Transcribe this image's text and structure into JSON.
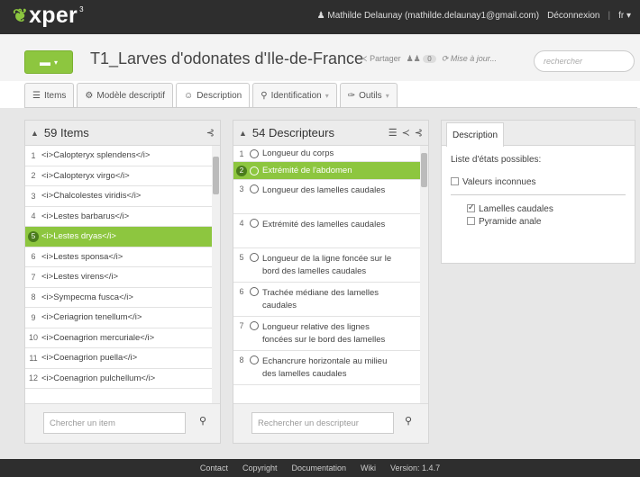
{
  "topbar": {
    "logo": "xper",
    "logo_sup": "3",
    "user": "Mathilde Delaunay (mathilde.delaunay1@gmail.com)",
    "logout": "Déconnexion",
    "lang": "fr"
  },
  "project": {
    "title": "T1_Larves d'odonates d'Ile-de-France",
    "share": "Partager",
    "badge": "0",
    "update": "Mise à jour...",
    "search_placeholder": "rechercher"
  },
  "tabs": [
    {
      "label": "Items"
    },
    {
      "label": "Modèle descriptif"
    },
    {
      "label": "Description"
    },
    {
      "label": "Identification"
    },
    {
      "label": "Outils"
    }
  ],
  "items_panel": {
    "title": "59 Items",
    "search_placeholder": "Chercher un item",
    "items": [
      {
        "num": "1",
        "label": "<i>Calopteryx splendens</i>"
      },
      {
        "num": "2",
        "label": "<i>Calopteryx virgo</i>"
      },
      {
        "num": "3",
        "label": "<i>Chalcolestes viridis</i>"
      },
      {
        "num": "4",
        "label": "<i>Lestes barbarus</i>"
      },
      {
        "num": "5",
        "label": "<i>Lestes dryas</i>"
      },
      {
        "num": "6",
        "label": "<i>Lestes sponsa</i>"
      },
      {
        "num": "7",
        "label": "<i>Lestes virens</i>"
      },
      {
        "num": "8",
        "label": "<i>Sympecma fusca</i>"
      },
      {
        "num": "9",
        "label": "<i>Ceriagrion tenellum</i>"
      },
      {
        "num": "10",
        "label": "<i>Coenagrion mercuriale</i>"
      },
      {
        "num": "11",
        "label": "<i>Coenagrion puella</i>"
      },
      {
        "num": "12",
        "label": "<i>Coenagrion pulchellum</i>"
      }
    ]
  },
  "descriptors_panel": {
    "title": "54 Descripteurs",
    "search_placeholder": "Rechercher un descripteur",
    "items": [
      {
        "num": "1",
        "label": "Longueur du corps"
      },
      {
        "num": "2",
        "label": "Extrémité de l'abdomen"
      },
      {
        "num": "3",
        "label": "Longueur des lamelles caudales"
      },
      {
        "num": "4",
        "label": "Extrémité des lamelles caudales"
      },
      {
        "num": "5",
        "label": "Longueur de la ligne foncée sur le bord des lamelles caudales"
      },
      {
        "num": "6",
        "label": "Trachée médiane des lamelles caudales"
      },
      {
        "num": "7",
        "label": "Longueur relative des lignes foncées sur le bord des lamelles"
      },
      {
        "num": "8",
        "label": "Echancrure horizontale au milieu des lamelles caudales"
      }
    ]
  },
  "description_panel": {
    "tab": "Description",
    "states_label": "Liste d'états possibles:",
    "unknown": "Valeurs inconnues",
    "states": [
      {
        "label": "Lamelles caudales"
      },
      {
        "label": "Pyramide anale"
      }
    ]
  },
  "footer": {
    "links": [
      "Contact",
      "Copyright",
      "Documentation",
      "Wiki",
      "Version: 1.4.7"
    ]
  },
  "colors": {
    "accent": "#8dc63f",
    "topbar": "#2e2e2e"
  }
}
